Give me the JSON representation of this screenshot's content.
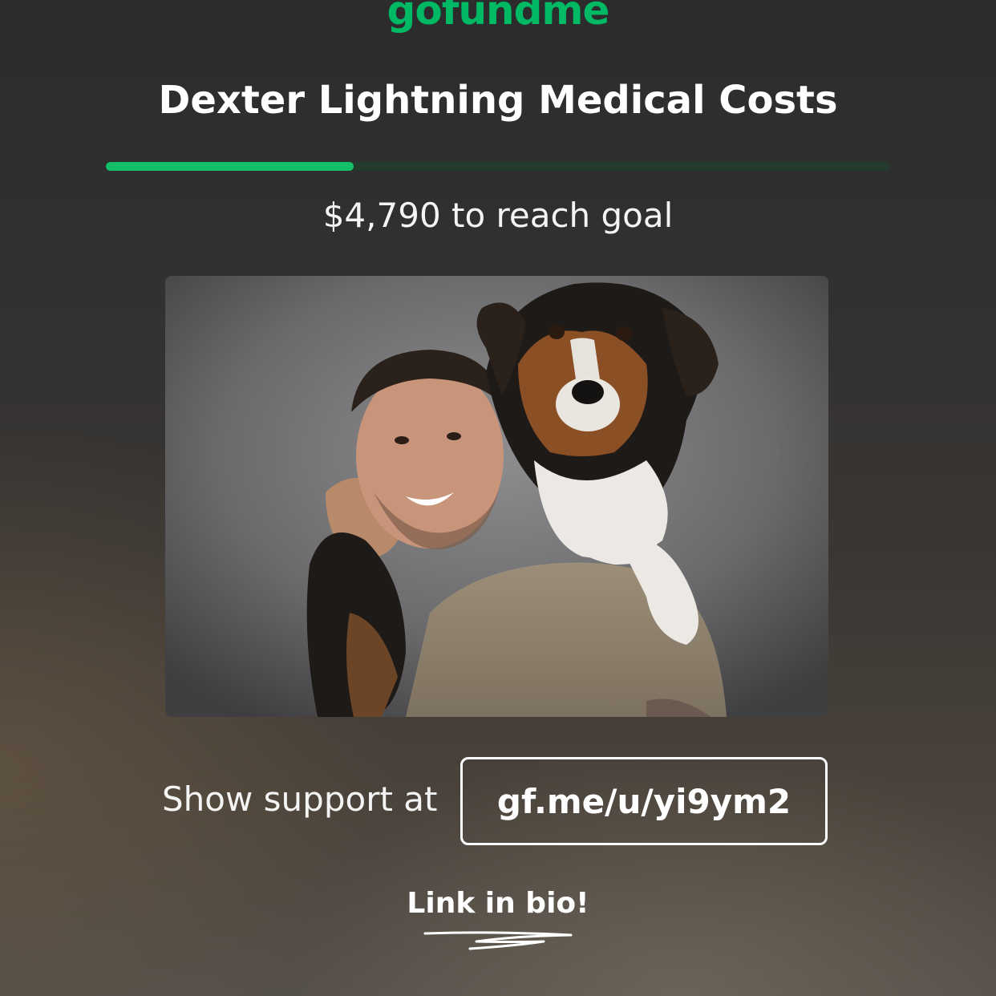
{
  "brand": {
    "logo_text": "gofundme",
    "accent_color": "#00b964"
  },
  "campaign": {
    "title": "Dexter Lightning Medical Costs",
    "progress_fraction": 0.316,
    "remaining_text": "$4,790 to reach goal",
    "photo_icon": "man-with-dog-photo"
  },
  "cta": {
    "support_label": "Show support at",
    "link": "gf.me/u/yi9ym2",
    "bio_text": "Link in bio!"
  }
}
